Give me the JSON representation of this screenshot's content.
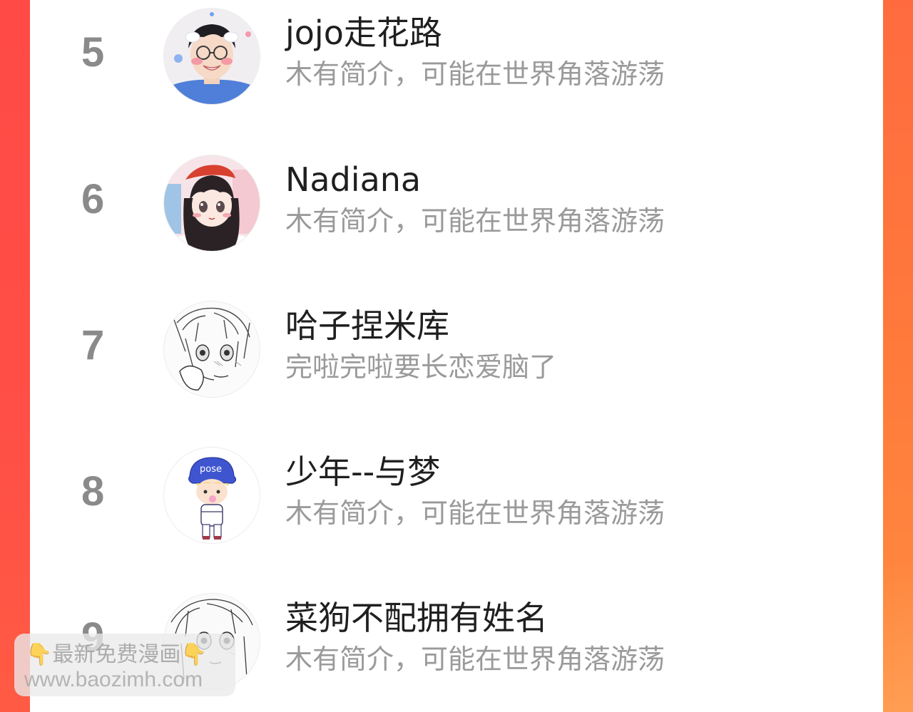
{
  "ranking": {
    "items": [
      {
        "rank": "5",
        "name": "jojo走花路",
        "bio": "木有简介，可能在世界角落游荡",
        "avatar_icon": "avatar-boy-photo-icon"
      },
      {
        "rank": "6",
        "name": "Nadiana",
        "bio": "木有简介，可能在世界角落游荡",
        "avatar_icon": "avatar-anime-girl-icon"
      },
      {
        "rank": "7",
        "name": "哈子捏米库",
        "bio": "完啦完啦要长恋爱脑了",
        "avatar_icon": "avatar-manga-sketch-icon"
      },
      {
        "rank": "8",
        "name": "少年--与梦",
        "bio": "木有简介，可能在世界角落游荡",
        "avatar_icon": "avatar-chibi-boy-icon"
      },
      {
        "rank": "9",
        "name": "菜狗不配拥有姓名",
        "bio": "木有简介，可能在世界角落游荡",
        "avatar_icon": "avatar-manga-girl-icon"
      }
    ]
  },
  "watermark": {
    "line1": "👇最新免费漫画👇",
    "line2": "www.baozimh.com"
  },
  "colors": {
    "background_accent": "#ff5c43",
    "rank_number": "#8a8a8a",
    "name_text": "#1f1f1f",
    "bio_text": "#9a9a9a",
    "panel": "#ffffff"
  }
}
